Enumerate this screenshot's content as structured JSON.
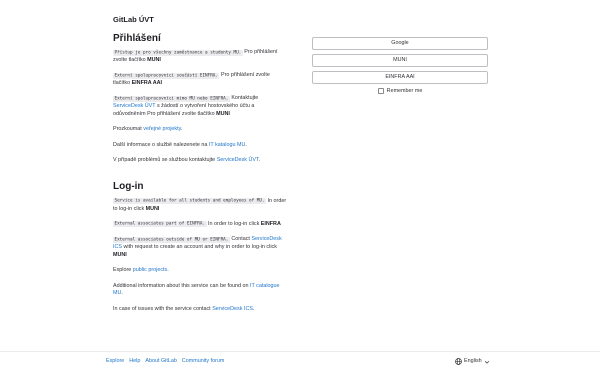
{
  "header": {
    "site_name": "GitLab ÚVT"
  },
  "cz": {
    "heading": "Přihlášení",
    "p1": {
      "code": "Přístup je pro všechny zaměstnance a studenty MU.",
      "text": " Pro přihlášení zvolte tlačítko ",
      "bold": "MUNI"
    },
    "p2": {
      "code": "Externí spolupracovníci součástí EINFRA.",
      "text": " Pro přihlášení zvolte tlačítko ",
      "bold": "EINFRA AAI"
    },
    "p3": {
      "code": "Externí spolupracovníci mimo MU nebo EINFRA.",
      "text_before": " Kontaktujte ",
      "link": "ServiceDesk ÚVT",
      "text_after": " s žádostí o vytvoření hostovského účtu a odůvodněním Pro přihlášení zvolte tlačítko ",
      "bold": "MUNI"
    },
    "p4": {
      "text": "Prozkoumat ",
      "link": "veřejné projekty",
      "end": "."
    },
    "p5": {
      "text": "Další informace o službě nalezenete na ",
      "link": "IT katalogu MU",
      "end": "."
    },
    "p6": {
      "text": "V případě problémů se službou kontaktujte ",
      "link": "ServiceDesk ÚVT",
      "end": "."
    }
  },
  "en": {
    "heading": "Log-in",
    "p1": {
      "code": "Service is available for all students and employees of MU.",
      "text": " In order to log-in click ",
      "bold": "MUNI"
    },
    "p2": {
      "code": "External associates part of EINFRA.",
      "text": " In order to log-in click ",
      "bold": "EINFRA"
    },
    "p3": {
      "code": "External associates outside of MU or EINFRA.",
      "text_before": " Contact ",
      "link": "ServiceDesk ICS",
      "text_after": " with request to create an account and why in order to log-in click ",
      "bold": "MUNI"
    },
    "p4": {
      "text": "Explore ",
      "link": "public projects",
      "end": "."
    },
    "p5": {
      "text": "Additional information about this service can be found on ",
      "link": "IT catalogue MU",
      "end": "."
    },
    "p6": {
      "text": "In case of issues with the service contact ",
      "link": "ServiceDesk ICS",
      "end": "."
    }
  },
  "sso": {
    "google": "Google",
    "muni": "MUNI",
    "einfra": "EINFRA AAI",
    "remember": "Remember me"
  },
  "footer": {
    "explore": "Explore",
    "help": "Help",
    "about": "About GitLab",
    "forum": "Community forum",
    "language": "English"
  }
}
